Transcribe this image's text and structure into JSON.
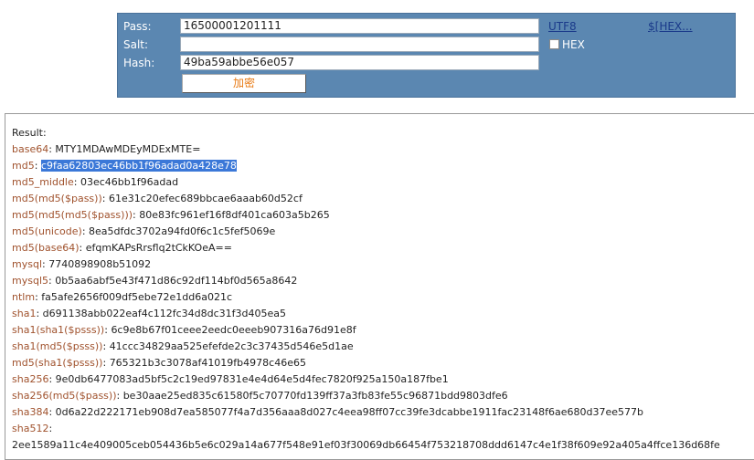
{
  "form": {
    "pass_label": "Pass:",
    "pass_value": "16500001201111",
    "salt_label": "Salt:",
    "salt_value": "",
    "hash_label": "Hash:",
    "hash_value": "49ba59abbe56e057",
    "utf8_link": "UTF8",
    "hex_link": "$[HEX...",
    "hex_checkbox_label": "HEX",
    "hex_checked": false,
    "encrypt_button": "加密"
  },
  "result": {
    "title": "Result:",
    "lines": [
      {
        "key": "base64",
        "value": "MTY1MDAwMDEyMDExMTE="
      },
      {
        "key": "md5",
        "value": "c9faa62803ec46bb1f96adad0a428e78",
        "selected": true
      },
      {
        "key": "md5_middle",
        "value": "03ec46bb1f96adad"
      },
      {
        "key": "md5(md5($pass))",
        "value": "61e31c20efec689bbcae6aaab60d52cf"
      },
      {
        "key": "md5(md5(md5($pass)))",
        "value": "80e83fc961ef16f8df401ca603a5b265"
      },
      {
        "key": "md5(unicode)",
        "value": "8ea5dfdc3702a94fd0f6c1c5fef5069e"
      },
      {
        "key": "md5(base64)",
        "value": "efqmKAPsRrsflq2tCkKOeA=="
      },
      {
        "key": "mysql",
        "value": "7740898908b51092"
      },
      {
        "key": "mysql5",
        "value": "0b5aa6abf5e43f471d86c92df114bf0d565a8642"
      },
      {
        "key": "ntlm",
        "value": "fa5afe2656f009df5ebe72e1dd6a021c"
      },
      {
        "key": "sha1",
        "value": "d691138abb022eaf4c112fc34d8dc31f3d405ea5"
      },
      {
        "key": "sha1(sha1($psss))",
        "value": "6c9e8b67f01ceee2eedc0eeeb907316a76d91e8f"
      },
      {
        "key": "sha1(md5($psss))",
        "value": "41ccc34829aa525efefde2c3c37435d546e5d1ae"
      },
      {
        "key": "md5(sha1($psss))",
        "value": "765321b3c3078af41019fb4978c46e65"
      },
      {
        "key": "sha256",
        "value": "9e0db6477083ad5bf5c2c19ed97831e4e4d64e5d4fec7820f925a150a187fbe1"
      },
      {
        "key": "sha256(md5($pass))",
        "value": "be30aae25ed835c61580f5c70770fd139ff37a3fb83fe55c96871bdd9803dfe6"
      },
      {
        "key": "sha384",
        "value": "0d6a22d222171eb908d7ea585077f4a7d356aaa8d027c4eea98ff07cc39fe3dcabbe1911fac23148f6ae680d37ee577b"
      },
      {
        "key": "sha512",
        "value": ""
      },
      {
        "key": "",
        "value": "2ee1589a11c4e409005ceb054436b5e6c029a14a677f548e91ef03f30069db66454f753218708ddd6147c4e1f38f609e92a405a4ffce136d68fe"
      }
    ]
  }
}
